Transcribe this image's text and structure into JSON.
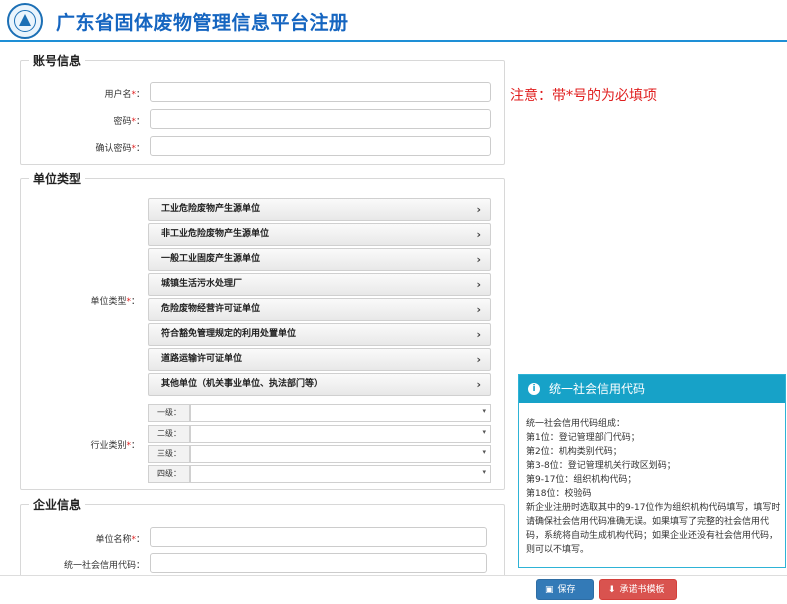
{
  "header": {
    "title": "广东省固体废物管理信息平台注册"
  },
  "account": {
    "legend": "账号信息",
    "username_label": "用户名",
    "password_label": "密码",
    "confirm_label": "确认密码",
    "required_mark": "*",
    "colon": "："
  },
  "notice": "注意：带*号的为必填项",
  "unit_type": {
    "legend": "单位类型",
    "field_label": "单位类型",
    "items": [
      "工业危险废物产生源单位",
      "非工业危险废物产生源单位",
      "一般工业固废产生源单位",
      "城镇生活污水处理厂",
      "危险废物经营许可证单位",
      "符合豁免管理规定的利用处置单位",
      "道路运输许可证单位",
      "其他单位（机关事业单位、执法部门等）"
    ],
    "chevron": "›"
  },
  "industry": {
    "field_label": "行业类别",
    "levels": [
      "一级：",
      "二级：",
      "三级：",
      "四级："
    ],
    "arrow": "▾"
  },
  "company": {
    "legend": "企业信息",
    "name_label": "单位名称",
    "credit_label": "统一社会信用代码："
  },
  "info_panel": {
    "icon": "i",
    "title": "统一社会信用代码",
    "lines": [
      "统一社会信用代码组成：",
      "第1位：登记管理部门代码；",
      "第2位：机构类别代码；",
      "第3-8位：登记管理机关行政区划码；",
      "第9-17位：组织机构代码；",
      "第18位：校验码",
      "新企业注册时选取其中的9-17位作为组织机构代码填写，填写时请确保社会信用代码准确无误。如果填写了完整的社会信用代码，系统将自动生成机构代码；如果企业还没有社会信用代码，则可以不填写。"
    ]
  },
  "buttons": {
    "save": "保存",
    "save_icon": "▣",
    "template": "承诺书模板",
    "template_icon": "⬇"
  }
}
